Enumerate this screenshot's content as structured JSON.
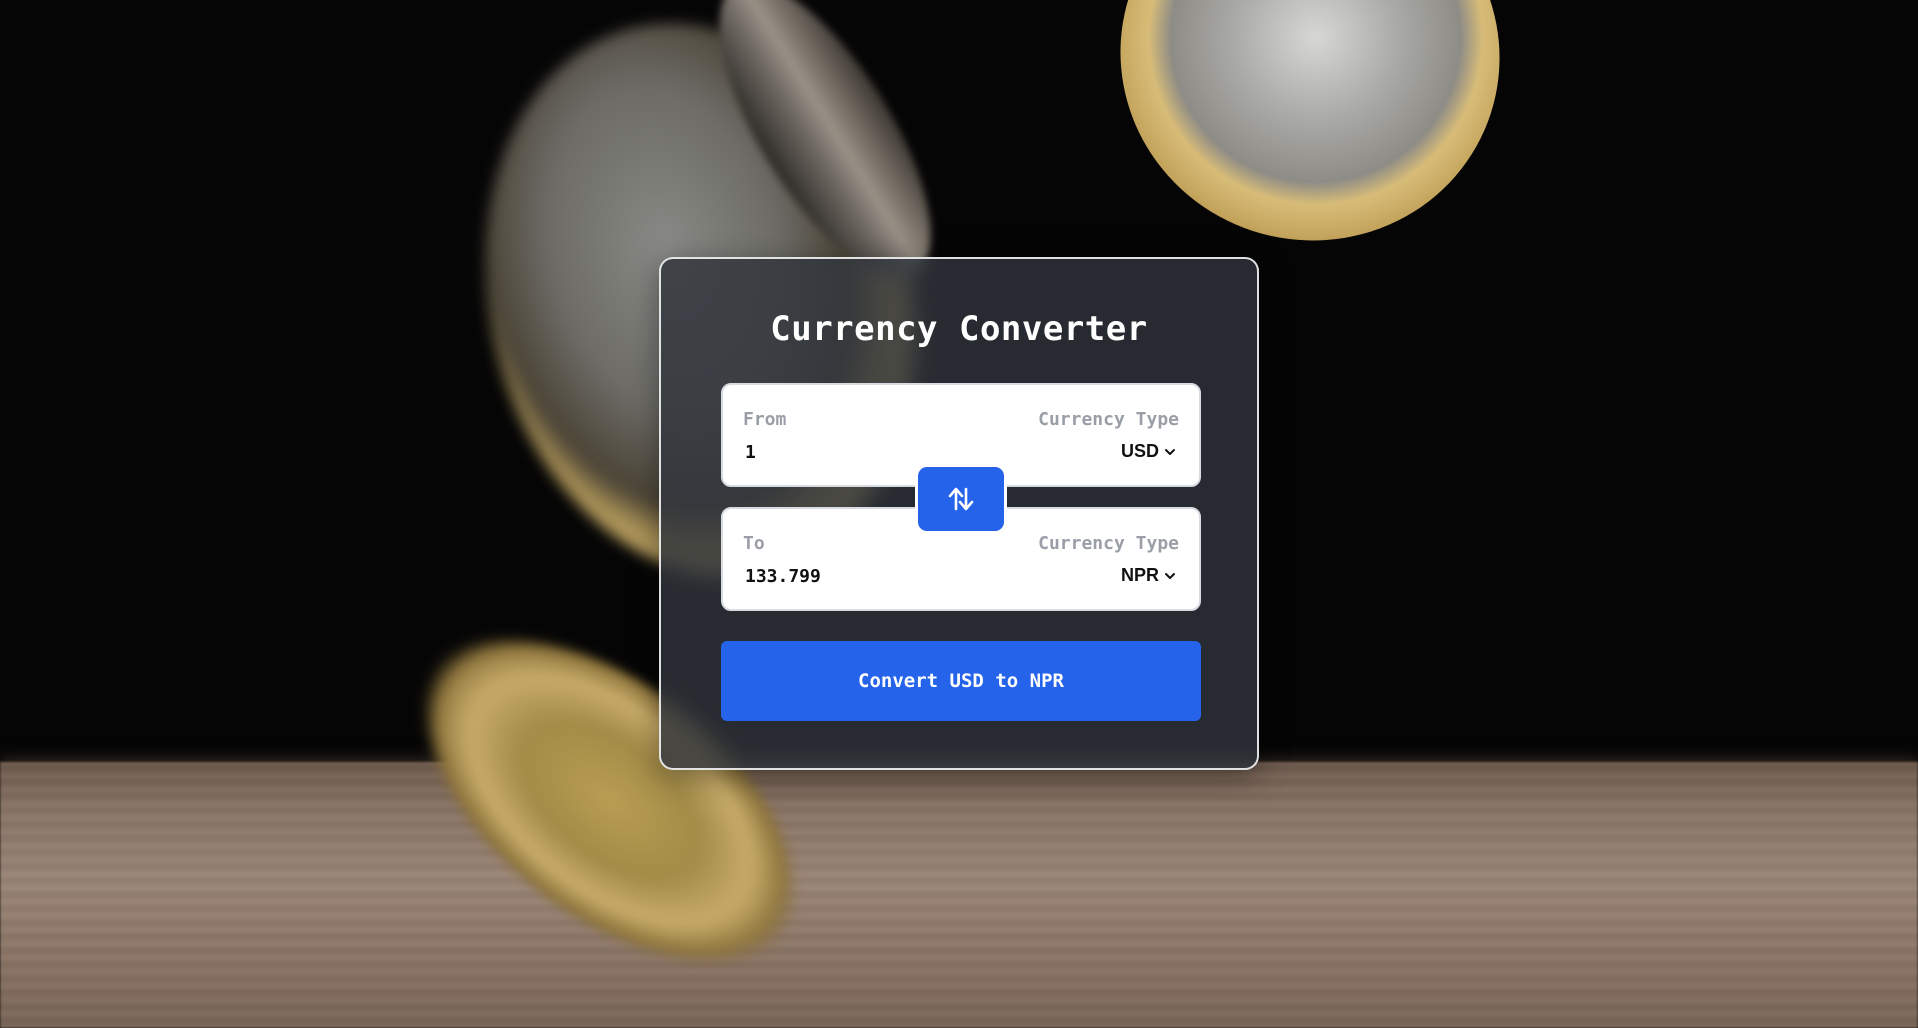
{
  "title": "Currency Converter",
  "from": {
    "label": "From",
    "type_label": "Currency Type",
    "amount": "1",
    "currency": "USD"
  },
  "to": {
    "label": "To",
    "type_label": "Currency Type",
    "amount": "133.799",
    "currency": "NPR"
  },
  "swap_icon": "swap-vertical-arrows-icon",
  "convert_label": "Convert USD to NPR",
  "colors": {
    "accent": "#2563eb",
    "card": "#30343c",
    "label": "#9a9ea7"
  }
}
